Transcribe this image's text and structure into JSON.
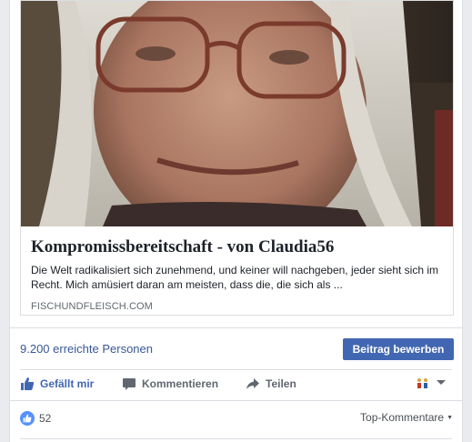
{
  "preview": {
    "image_alt": "",
    "title": "Kompromissbereitschaft - von Claudia56",
    "description": "Die Welt radikalisiert sich zunehmend, und keiner will nachgeben, jeder sieht sich im Recht. Mich amüsiert daran am meisten, dass die, die sich als ...",
    "domain": "FISCHUNDFLEISCH.COM"
  },
  "insights": {
    "reach_label": "9.200 erreichte Personen",
    "boost_label": "Beitrag bewerben"
  },
  "actions": {
    "like_label": "Gefällt mir",
    "comment_label": "Kommentieren",
    "share_label": "Teilen"
  },
  "reactions": {
    "like_count": "52",
    "sort_label": "Top-Kommentare"
  },
  "colors": {
    "accent": "#4267b2",
    "link": "#385898",
    "muted": "#606770"
  },
  "icons": [
    "thumbs-up-icon",
    "comment-bubble-icon",
    "share-arrow-icon",
    "page-avatar-icon",
    "chevron-down-icon",
    "like-reaction-icon"
  ]
}
